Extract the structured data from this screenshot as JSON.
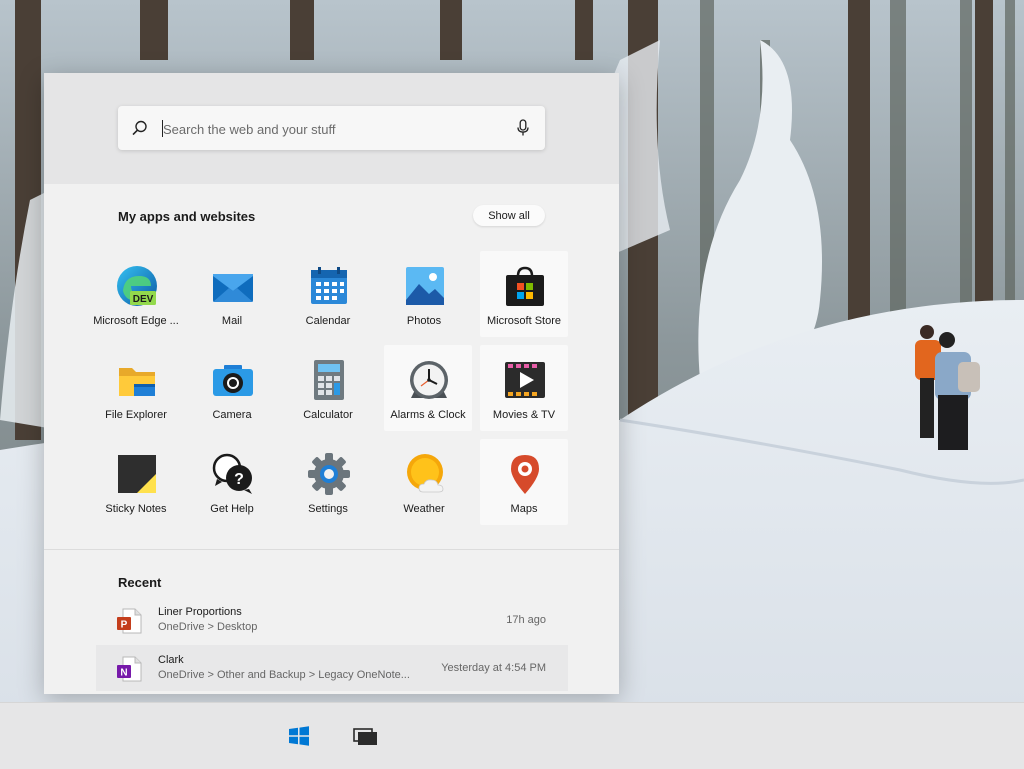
{
  "search": {
    "placeholder": "Search the web and your stuff",
    "icon": "search-icon",
    "mic_icon": "microphone-icon"
  },
  "apps_section": {
    "title": "My apps and websites",
    "show_all": "Show all",
    "apps": [
      {
        "label": "Microsoft Edge ...",
        "icon": "edge-dev-icon"
      },
      {
        "label": "Mail",
        "icon": "mail-icon"
      },
      {
        "label": "Calendar",
        "icon": "calendar-icon"
      },
      {
        "label": "Photos",
        "icon": "photos-icon"
      },
      {
        "label": "Microsoft Store",
        "icon": "store-icon"
      },
      {
        "label": "File Explorer",
        "icon": "folder-icon"
      },
      {
        "label": "Camera",
        "icon": "camera-icon"
      },
      {
        "label": "Calculator",
        "icon": "calculator-icon"
      },
      {
        "label": "Alarms & Clock",
        "icon": "clock-icon"
      },
      {
        "label": "Movies & TV",
        "icon": "movies-icon"
      },
      {
        "label": "Sticky Notes",
        "icon": "sticky-notes-icon"
      },
      {
        "label": "Get Help",
        "icon": "help-icon"
      },
      {
        "label": "Settings",
        "icon": "gear-icon"
      },
      {
        "label": "Weather",
        "icon": "weather-icon"
      },
      {
        "label": "Maps",
        "icon": "map-pin-icon"
      }
    ]
  },
  "recent_section": {
    "title": "Recent",
    "items": [
      {
        "name": "Liner Proportions",
        "path": "OneDrive > Desktop",
        "time": "17h ago",
        "icon": "powerpoint-icon"
      },
      {
        "name": "Clark",
        "path": "OneDrive > Other and Backup > Legacy OneNote...",
        "time": "Yesterday at 4:54 PM",
        "icon": "onenote-icon"
      }
    ]
  },
  "taskbar": {
    "start_icon": "windows-logo-icon",
    "task_view_icon": "task-view-icon"
  },
  "colors": {
    "accent": "#0078d4",
    "panel": "#f1f1f1",
    "taskbar": "#e6e6e7"
  }
}
